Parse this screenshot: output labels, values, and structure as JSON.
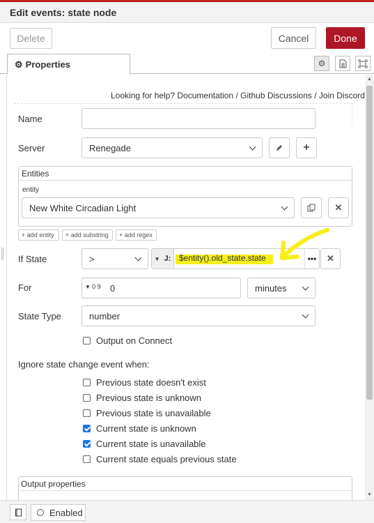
{
  "dialog": {
    "title": "Edit events: state node",
    "delete_label": "Delete",
    "cancel_label": "Cancel",
    "done_label": "Done",
    "tab_properties": "Properties",
    "accent_color": "#ad1625"
  },
  "help": {
    "prefix": "Looking for help?",
    "links": [
      "Documentation",
      "Github Discussions",
      "Join Discord"
    ]
  },
  "form": {
    "name_label": "Name",
    "name_value": "",
    "server_label": "Server",
    "server_value": "Renegade",
    "entities_header": "Entities",
    "entity_label": "entity",
    "entity_value": "New White Circadian Light",
    "add_entity": "+ add entity",
    "add_substring": "+ add substring",
    "add_regex": "+ add regex",
    "if_state_label": "If State",
    "if_state_operator": ">",
    "if_state_type_icon": "J:",
    "if_state_value": "$entity().old_state.state",
    "highlight_color": "#f5ef1a",
    "for_label": "For",
    "for_type_icon": "0 9",
    "for_value": "0",
    "for_unit": "minutes",
    "state_type_label": "State Type",
    "state_type_value": "number",
    "output_on_connect": "Output on Connect",
    "ignore_label": "Ignore state change event when:",
    "ignore_options": [
      {
        "label": "Previous state doesn't exist",
        "checked": false
      },
      {
        "label": "Previous state is unknown",
        "checked": false
      },
      {
        "label": "Previous state is unavailable",
        "checked": false
      },
      {
        "label": "Current state is unknown",
        "checked": true
      },
      {
        "label": "Current state is unavailable",
        "checked": true
      },
      {
        "label": "Current state equals previous state",
        "checked": false
      }
    ],
    "output_properties": "Output properties"
  },
  "footer": {
    "enabled_label": "Enabled"
  }
}
